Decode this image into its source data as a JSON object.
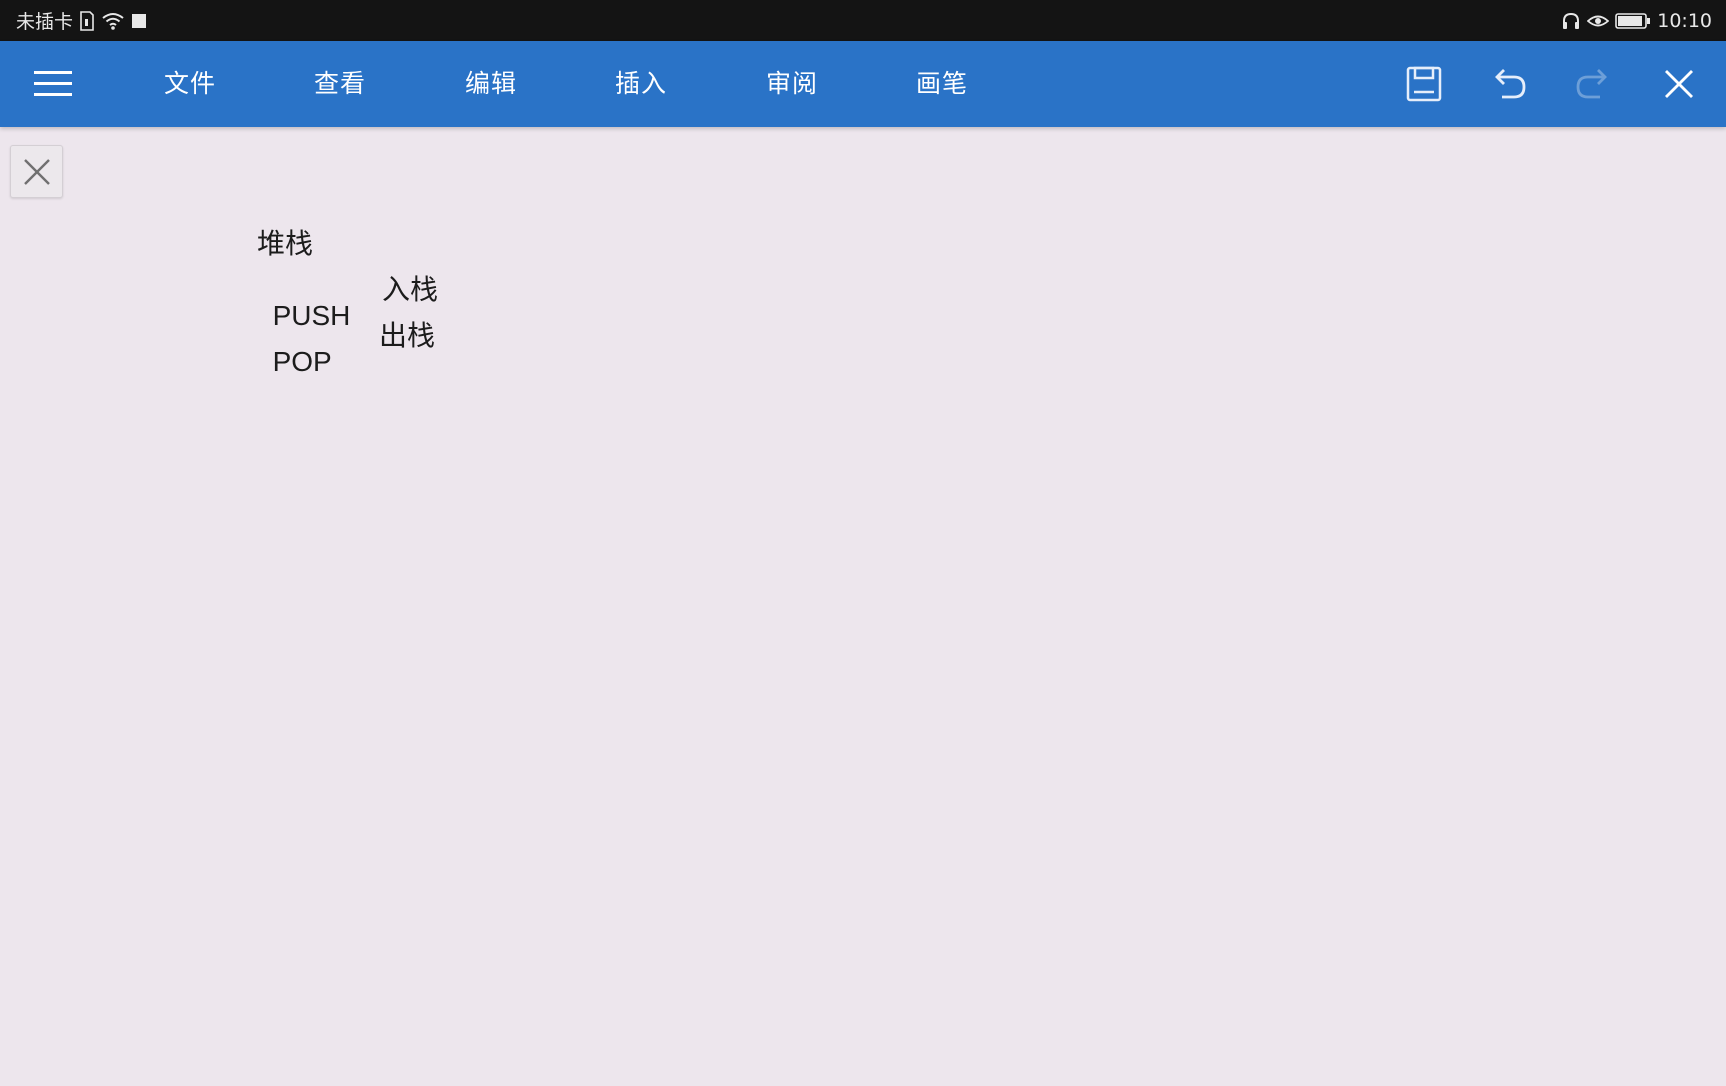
{
  "status_bar": {
    "carrier": "未插卡",
    "time": "10:10",
    "icons": [
      "sim-icon",
      "wifi-icon",
      "notification-square-icon",
      "headphones-icon",
      "eye-comfort-icon",
      "battery-icon"
    ]
  },
  "toolbar": {
    "menu_icon": "hamburger-menu-icon",
    "items": [
      "文件",
      "查看",
      "编辑",
      "插入",
      "审阅",
      "画笔"
    ],
    "actions": [
      "save-icon",
      "undo-icon",
      "redo-icon",
      "close-icon"
    ]
  },
  "document": {
    "heading": "堆栈",
    "rows": [
      {
        "term": "PUSH",
        "meaning": "入栈"
      },
      {
        "term": "POP",
        "meaning": "出栈"
      }
    ]
  },
  "colors": {
    "toolbar": "#2a73c7",
    "status_bar": "#141414",
    "page_background": "#ede6ed"
  }
}
